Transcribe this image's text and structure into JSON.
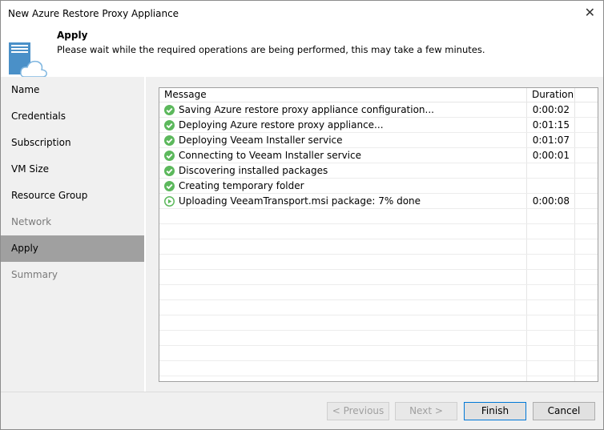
{
  "window": {
    "title": "New Azure Restore Proxy Appliance",
    "close": "✕"
  },
  "header": {
    "title": "Apply",
    "subtitle": "Please wait while the required operations are being performed, this may take a few minutes."
  },
  "sidebar": {
    "items": [
      {
        "label": "Name",
        "state": "normal"
      },
      {
        "label": "Credentials",
        "state": "normal"
      },
      {
        "label": "Subscription",
        "state": "normal"
      },
      {
        "label": "VM Size",
        "state": "normal"
      },
      {
        "label": "Resource Group",
        "state": "normal"
      },
      {
        "label": "Network",
        "state": "disabled"
      },
      {
        "label": "Apply",
        "state": "active"
      },
      {
        "label": "Summary",
        "state": "disabled"
      }
    ]
  },
  "table": {
    "columns": [
      "Message",
      "Duration"
    ],
    "rows": [
      {
        "status": "success",
        "message": "Saving Azure restore proxy appliance configuration...",
        "duration": "0:00:02"
      },
      {
        "status": "success",
        "message": "Deploying Azure restore proxy appliance...",
        "duration": "0:01:15"
      },
      {
        "status": "success",
        "message": "Deploying Veeam Installer service",
        "duration": "0:01:07"
      },
      {
        "status": "success",
        "message": "Connecting to Veeam Installer service",
        "duration": "0:00:01"
      },
      {
        "status": "success",
        "message": "Discovering installed packages",
        "duration": ""
      },
      {
        "status": "success",
        "message": "Creating temporary folder",
        "duration": ""
      },
      {
        "status": "running",
        "message": "Uploading VeeamTransport.msi package: 7% done",
        "duration": "0:00:08"
      }
    ]
  },
  "buttons": {
    "previous": "< Previous",
    "next": "Next >",
    "finish": "Finish",
    "cancel": "Cancel"
  },
  "colors": {
    "success": "#5cb85c",
    "active_nav": "#a0a0a0",
    "accent": "#0078d7"
  }
}
